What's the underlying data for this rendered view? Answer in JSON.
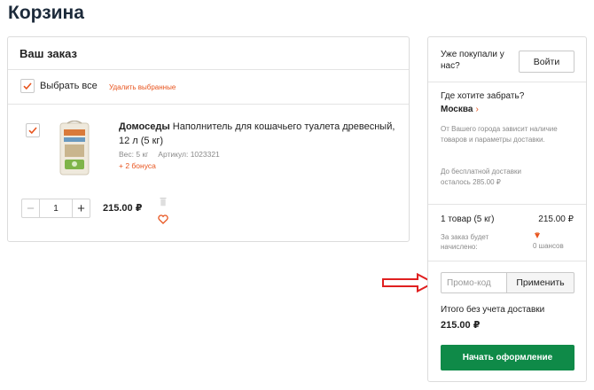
{
  "page": {
    "title": "Корзина"
  },
  "order": {
    "title": "Ваш заказ",
    "select_all_label": "Выбрать все",
    "select_all_checked": true,
    "delete_selected_label": "Удалить выбранные"
  },
  "product": {
    "checked": true,
    "brand": "Домоседы",
    "name": " Наполнитель для кошачьего туалета древесный, 12 л (5 кг)",
    "weight": "Вес: 5 кг",
    "sku": "Артикул: 1023321",
    "bonus": "+ 2 бонуса",
    "quantity": "1",
    "minus_icon": "−",
    "plus_icon": "+",
    "price": "215.00 ₽"
  },
  "summary": {
    "bought_before": "Уже покупали у нас?",
    "login_label": "Войти",
    "pickup_question": "Где хотите забрать?",
    "city": "Москва",
    "city_chevron": "›",
    "city_note": "От Вашего города зависит наличие товаров и параметры доставки.",
    "free_delivery": "До бесплатной доставки осталось 285.00 ₽",
    "items_count": "1 товар (5 кг)",
    "items_price": "215.00 ₽",
    "will_accrue": "За заказ будет начислено:",
    "chances": "0 шансов",
    "promo_placeholder": "Промо-код",
    "apply_label": "Применить",
    "total_label": "Итого без учета доставки",
    "total_value": "215.00 ₽",
    "checkout_label": "Начать оформление"
  },
  "colors": {
    "accent": "#e8541e",
    "checkout": "#0f8a48",
    "arrow": "#e02020"
  },
  "icons": [
    "checkmark-icon",
    "trash-icon",
    "heart-icon",
    "chevron-right-icon",
    "chances-icon",
    "red-arrow-icon"
  ]
}
